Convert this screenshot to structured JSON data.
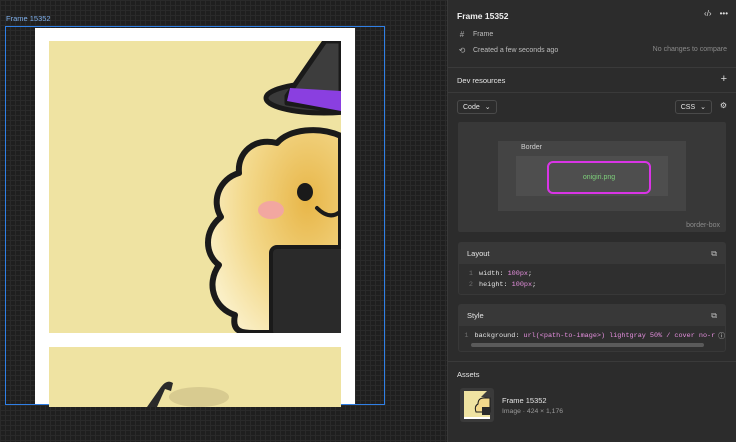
{
  "canvas": {
    "frame_label": "Frame 15352"
  },
  "panel": {
    "title": "Frame 15352",
    "meta": {
      "type_label": "Frame",
      "created": "Created a few seconds ago",
      "changes": "No changes to compare"
    },
    "dev_resources": {
      "title": "Dev resources",
      "add_icon": "plus-icon"
    },
    "code_select": {
      "value": "Code"
    },
    "lang_select": {
      "value": "CSS"
    },
    "box_model": {
      "border_label": "Border",
      "content_label": "onigiri.png",
      "box_sizing": "border-box",
      "dash": "-"
    },
    "layout": {
      "title": "Layout",
      "lines": [
        {
          "num": "1",
          "prop": "width",
          "value": "100px"
        },
        {
          "num": "2",
          "prop": "height",
          "value": "100px"
        }
      ]
    },
    "style": {
      "title": "Style",
      "lines": [
        {
          "num": "1",
          "prop": "background",
          "value": "url(<path-to-image>) lightgray 50% / cover no-r"
        }
      ]
    },
    "assets": {
      "title": "Assets",
      "name": "Frame 15352",
      "meta": "Image · 424 × 1,176"
    }
  },
  "colors": {
    "selection": "#2f7fe5",
    "highlight": "#d934e6",
    "card_bg": "#efe3a2"
  }
}
